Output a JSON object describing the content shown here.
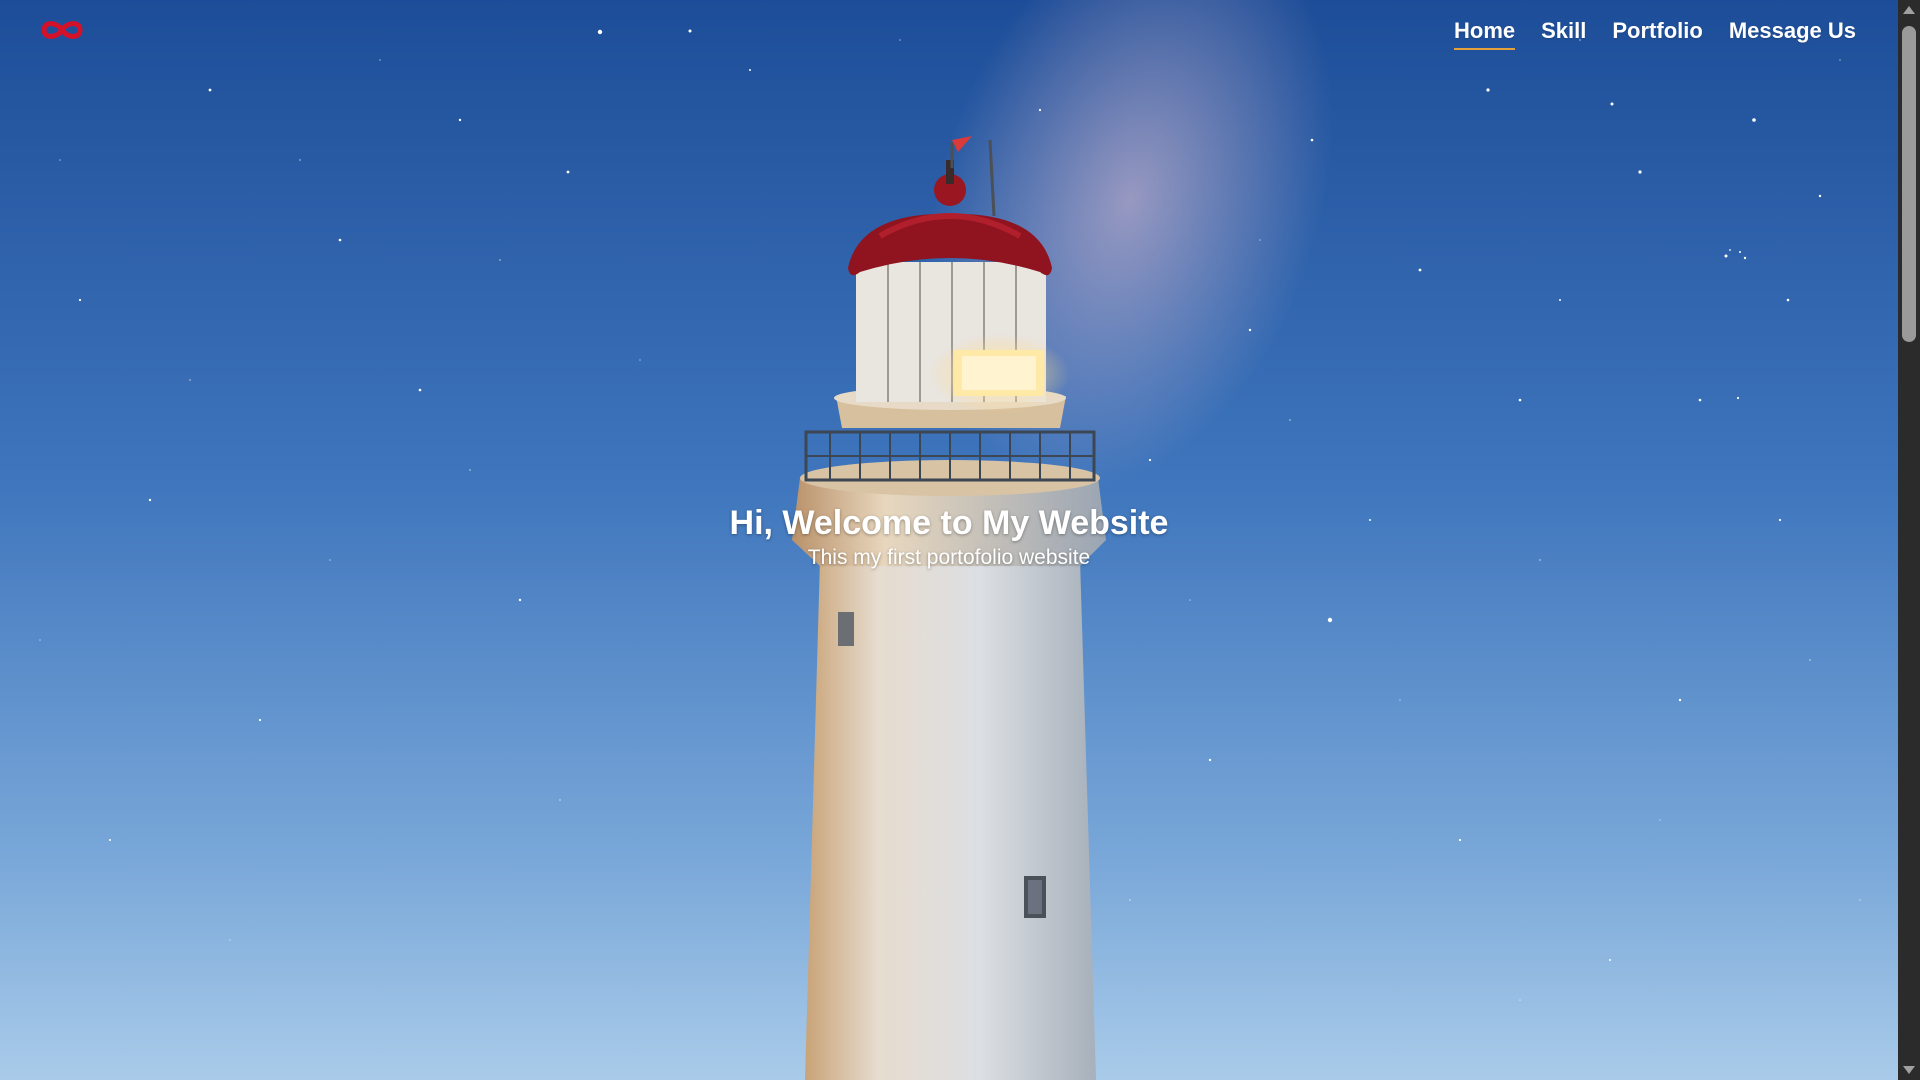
{
  "navbar": {
    "logo_icon": "infinity-icon",
    "items": [
      {
        "label": "Home",
        "active": true
      },
      {
        "label": "Skill",
        "active": false
      },
      {
        "label": "Portfolio",
        "active": false
      },
      {
        "label": "Message Us",
        "active": false
      }
    ]
  },
  "hero": {
    "title": "Hi, Welcome to My Website",
    "subtitle": "This my first portofolio website",
    "background": "lighthouse under starry night sky"
  },
  "colors": {
    "logo": "#d3122a",
    "nav_text": "#ffffff",
    "active_underline": "#e2a13a",
    "sky_top": "#1f4f9a",
    "sky_bottom": "#9ec3e6",
    "scrollbar_track": "#2b2b2b",
    "scrollbar_thumb": "#9a9a9a"
  }
}
